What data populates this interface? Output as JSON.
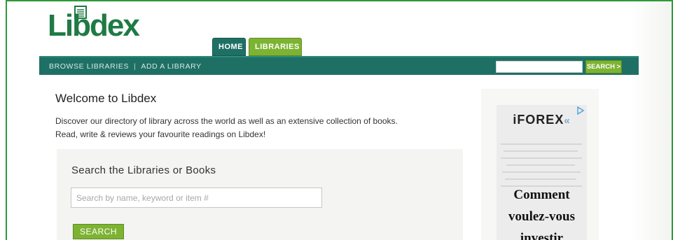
{
  "logo": {
    "text": "Libdex"
  },
  "tabs": [
    {
      "label": "HOME",
      "active": true
    },
    {
      "label": "LIBRARIES",
      "active": false
    }
  ],
  "nav": {
    "links": [
      "BROWSE LIBRARIES",
      "ADD A LIBRARY"
    ],
    "separator": "|",
    "search_button": "SEARCH >"
  },
  "main": {
    "title": "Welcome to Libdex",
    "body_line_1": "Discover our directory of library across the world as well as an extensive collection of books.",
    "body_line_2": "Read, write & reviews your favourite readings on Libdex!",
    "search": {
      "title": "Search the Libraries or Books",
      "placeholder": "Search by name, keyword or item #",
      "button": "SEARCH"
    }
  },
  "ad": {
    "brand": "iFOREX",
    "lines": [
      "Comment",
      "voulez-vous",
      "investir"
    ]
  },
  "colors": {
    "dark_teal": "#1f7064",
    "lime_green": "#7db332",
    "logo_green": "#1f7a45",
    "frame_green": "#2e9a3a"
  }
}
